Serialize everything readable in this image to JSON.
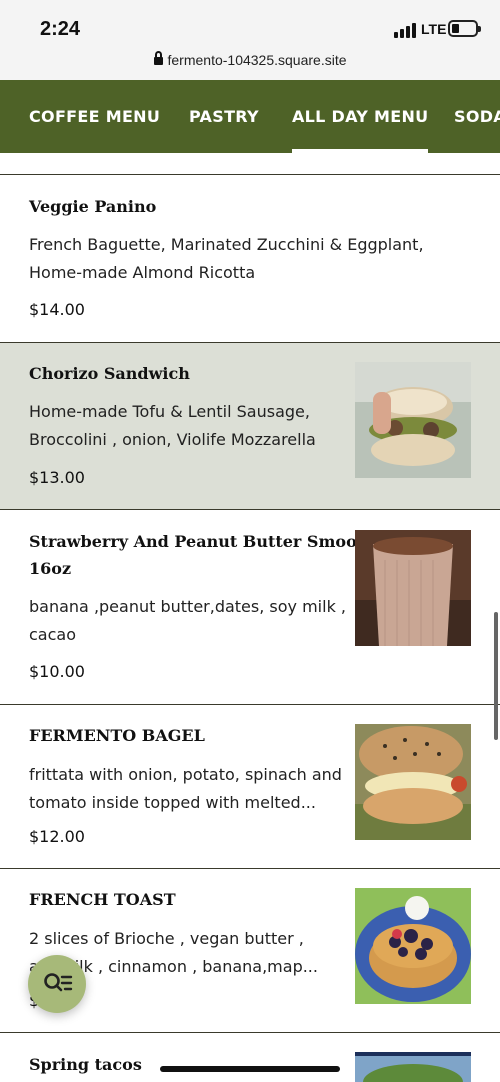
{
  "status": {
    "time": "2:24",
    "network": "LTE"
  },
  "browser": {
    "url": "fermento-104325.square.site"
  },
  "nav": {
    "tabs": [
      {
        "label": "COFFEE MENU",
        "active": false
      },
      {
        "label": "PASTRY",
        "active": false
      },
      {
        "label": "ALL DAY MENU",
        "active": true
      },
      {
        "label": "SODA",
        "active": false
      }
    ]
  },
  "menu": {
    "items": [
      {
        "name": "Veggie Panino",
        "desc_lines": [
          "French Baguette, Marinated Zucchini & Eggplant,",
          "Home-made Almond Ricotta"
        ],
        "price": "$14.00",
        "has_image": false
      },
      {
        "name": "Chorizo Sandwich",
        "desc_lines": [
          "Home-made Tofu & Lentil Sausage,",
          "Broccolini , onion, Violife Mozzarella"
        ],
        "price": "$13.00",
        "has_image": true,
        "image_icon": "sandwich-photo-icon"
      },
      {
        "name_lines": [
          "Strawberry And Peanut Butter Smoothie",
          "16oz"
        ],
        "desc_lines": [
          "banana ,peanut butter,dates, soy milk ,",
          "cacao"
        ],
        "price": "$10.00",
        "has_image": true,
        "image_icon": "smoothie-photo-icon"
      },
      {
        "name": "FERMENTO BAGEL",
        "desc_lines": [
          "frittata with onion, potato, spinach and",
          "tomato inside topped with melted..."
        ],
        "price": "$12.00",
        "has_image": true,
        "image_icon": "bagel-photo-icon"
      },
      {
        "name": "FRENCH TOAST",
        "desc_lines": [
          "2 slices of Brioche , vegan butter ,",
          "a    d milk , cinnamon , banana,map..."
        ],
        "price": "$",
        "has_image": true,
        "image_icon": "french-toast-photo-icon"
      },
      {
        "name": "Spring tacos",
        "has_image": true,
        "image_icon": "tacos-photo-icon"
      }
    ]
  },
  "fab": {
    "icon": "search-list-icon"
  },
  "colors": {
    "nav_bg": "#4e6227",
    "highlight_row": "#dcdfd6",
    "fab": "#a7b979"
  }
}
